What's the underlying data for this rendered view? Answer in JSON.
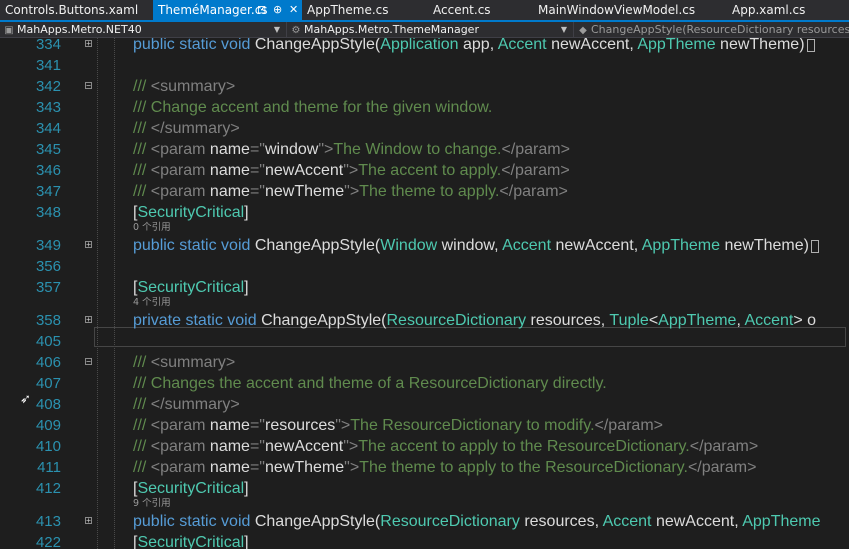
{
  "tabs": [
    {
      "label": "Controls.Buttons.xaml",
      "active": false
    },
    {
      "label": "TheméManager.cs",
      "active": true,
      "pin_icon": "⊡",
      "pushpin_icon": "⊕",
      "close_icon": "✕"
    },
    {
      "label": "AppTheme.cs",
      "active": false
    },
    {
      "label": "Accent.cs",
      "active": false
    },
    {
      "label": "MainWindowViewModel.cs",
      "active": false
    },
    {
      "label": "App.xaml.cs",
      "active": false
    }
  ],
  "navbar": {
    "project": "MahApps.Metro.NET40",
    "type": "MahApps.Metro.ThemeManager",
    "member": "ChangeAppStyle(ResourceDictionary resources, Ac"
  },
  "lines": [
    {
      "n": "334",
      "fold": "+",
      "segs": [
        [
          "kw",
          "public static void "
        ],
        [
          "pl",
          "ChangeAppStyle("
        ],
        [
          "ty",
          "Application"
        ],
        [
          "pl",
          " app, "
        ],
        [
          "ty",
          "Accent"
        ],
        [
          "pl",
          " newAccent, "
        ],
        [
          "ty",
          "AppTheme"
        ],
        [
          "pl",
          " newTheme)"
        ]
      ]
    },
    {
      "n": "341",
      "segs": []
    },
    {
      "n": "342",
      "fold": "−",
      "segs": [
        [
          "gr",
          "/// "
        ],
        [
          "xt",
          "<summary>"
        ]
      ]
    },
    {
      "n": "343",
      "segs": [
        [
          "gr",
          "/// Change accent and theme for the given window."
        ]
      ]
    },
    {
      "n": "344",
      "segs": [
        [
          "gr",
          "/// "
        ],
        [
          "xt",
          "</summary>"
        ]
      ]
    },
    {
      "n": "345",
      "segs": [
        [
          "gr",
          "/// "
        ],
        [
          "xt",
          "<param "
        ],
        [
          "pl",
          "name"
        ],
        [
          "xt",
          "=\""
        ],
        [
          "pl",
          "window"
        ],
        [
          "xt",
          "\">"
        ],
        [
          "gr",
          "The Window to change."
        ],
        [
          "xt",
          "</param>"
        ]
      ]
    },
    {
      "n": "346",
      "segs": [
        [
          "gr",
          "/// "
        ],
        [
          "xt",
          "<param "
        ],
        [
          "pl",
          "name"
        ],
        [
          "xt",
          "=\""
        ],
        [
          "pl",
          "newAccent"
        ],
        [
          "xt",
          "\">"
        ],
        [
          "gr",
          "The accent to apply."
        ],
        [
          "xt",
          "</param>"
        ]
      ]
    },
    {
      "n": "347",
      "segs": [
        [
          "gr",
          "/// "
        ],
        [
          "xt",
          "<param "
        ],
        [
          "pl",
          "name"
        ],
        [
          "xt",
          "=\""
        ],
        [
          "pl",
          "newTheme"
        ],
        [
          "xt",
          "\">"
        ],
        [
          "gr",
          "The theme to apply."
        ],
        [
          "xt",
          "</param>"
        ]
      ]
    },
    {
      "n": "348",
      "segs": [
        [
          "pl",
          "["
        ],
        [
          "ty",
          "SecurityCritical"
        ],
        [
          "pl",
          "]"
        ]
      ]
    },
    {
      "n": "349",
      "fold": "+",
      "segs": [
        [
          "kw",
          "public static void "
        ],
        [
          "pl",
          "ChangeAppStyle("
        ],
        [
          "ty",
          "Window"
        ],
        [
          "pl",
          " window, "
        ],
        [
          "ty",
          "Accent"
        ],
        [
          "pl",
          " newAccent, "
        ],
        [
          "ty",
          "AppTheme"
        ],
        [
          "pl",
          " newTheme)"
        ]
      ]
    },
    {
      "n": "356",
      "segs": []
    },
    {
      "n": "357",
      "segs": [
        [
          "pl",
          "["
        ],
        [
          "ty",
          "SecurityCritical"
        ],
        [
          "pl",
          "]"
        ]
      ]
    },
    {
      "n": "358",
      "fold": "+",
      "segs": [
        [
          "kw",
          "private static void "
        ],
        [
          "pl",
          "ChangeAppStyle("
        ],
        [
          "ty",
          "ResourceDictionary"
        ],
        [
          "pl",
          " resources, "
        ],
        [
          "ty",
          "Tuple"
        ],
        [
          "pl",
          "<"
        ],
        [
          "ty",
          "AppTheme"
        ],
        [
          "pl",
          ", "
        ],
        [
          "ty",
          "Accent"
        ],
        [
          "pl",
          "> o"
        ]
      ]
    },
    {
      "n": "405",
      "segs": []
    },
    {
      "n": "406",
      "fold": "−",
      "segs": [
        [
          "gr",
          "/// "
        ],
        [
          "xt",
          "<summary>"
        ]
      ]
    },
    {
      "n": "407",
      "segs": [
        [
          "gr",
          "/// Changes the accent and theme of a ResourceDictionary directly."
        ]
      ]
    },
    {
      "n": "408",
      "segs": [
        [
          "gr",
          "/// "
        ],
        [
          "xt",
          "</summary>"
        ]
      ]
    },
    {
      "n": "409",
      "segs": [
        [
          "gr",
          "/// "
        ],
        [
          "xt",
          "<param "
        ],
        [
          "pl",
          "name"
        ],
        [
          "xt",
          "=\""
        ],
        [
          "pl",
          "resources"
        ],
        [
          "xt",
          "\">"
        ],
        [
          "gr",
          "The ResourceDictionary to modify."
        ],
        [
          "xt",
          "</param>"
        ]
      ]
    },
    {
      "n": "410",
      "segs": [
        [
          "gr",
          "/// "
        ],
        [
          "xt",
          "<param "
        ],
        [
          "pl",
          "name"
        ],
        [
          "xt",
          "=\""
        ],
        [
          "pl",
          "newAccent"
        ],
        [
          "xt",
          "\">"
        ],
        [
          "gr",
          "The accent to apply to the ResourceDictionary."
        ],
        [
          "xt",
          "</param>"
        ]
      ]
    },
    {
      "n": "411",
      "segs": [
        [
          "gr",
          "/// "
        ],
        [
          "xt",
          "<param "
        ],
        [
          "pl",
          "name"
        ],
        [
          "xt",
          "=\""
        ],
        [
          "pl",
          "newTheme"
        ],
        [
          "xt",
          "\">"
        ],
        [
          "gr",
          "The theme to apply to the ResourceDictionary."
        ],
        [
          "xt",
          "</param>"
        ]
      ]
    },
    {
      "n": "412",
      "segs": [
        [
          "pl",
          "["
        ],
        [
          "ty",
          "SecurityCritical"
        ],
        [
          "pl",
          "]"
        ]
      ]
    },
    {
      "n": "413",
      "fold": "+",
      "segs": [
        [
          "kw",
          "public static void "
        ],
        [
          "pl",
          "ChangeAppStyle("
        ],
        [
          "ty",
          "ResourceDictionary"
        ],
        [
          "pl",
          " resources, "
        ],
        [
          "ty",
          "Accent"
        ],
        [
          "pl",
          " newAccent, "
        ],
        [
          "ty",
          "AppTheme"
        ]
      ]
    },
    {
      "n": "422",
      "segs": [
        [
          "pl",
          "["
        ],
        [
          "ty",
          "SecurityCritical"
        ],
        [
          "pl",
          "]"
        ]
      ]
    }
  ],
  "codelens": [
    {
      "after": "348",
      "text": "0 个引用"
    },
    {
      "after": "357",
      "text": "4 个引用"
    },
    {
      "after": "412",
      "text": "9 个引用"
    }
  ],
  "colors": {
    "accent": "#007acc",
    "keyword": "#569cd6",
    "type": "#4ec9b0",
    "comment": "#57a64a",
    "line_number": "#2b91af"
  }
}
